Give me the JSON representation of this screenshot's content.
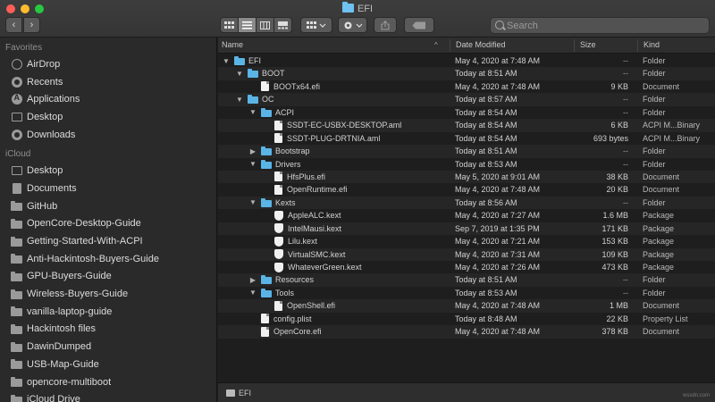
{
  "window": {
    "title": "EFI"
  },
  "toolbar": {
    "back_label": "‹",
    "forward_label": "›",
    "search_placeholder": "Search"
  },
  "sidebar": {
    "favorites_header": "Favorites",
    "favorites": [
      {
        "label": "AirDrop",
        "icon": "airdrop-icon"
      },
      {
        "label": "Recents",
        "icon": "clock-icon"
      },
      {
        "label": "Applications",
        "icon": "applications-icon"
      },
      {
        "label": "Desktop",
        "icon": "desktop-icon"
      },
      {
        "label": "Downloads",
        "icon": "downloads-icon"
      }
    ],
    "icloud_header": "iCloud",
    "icloud": [
      {
        "label": "Desktop",
        "icon": "desktop-icon"
      },
      {
        "label": "Documents",
        "icon": "documents-icon"
      },
      {
        "label": "GitHub",
        "icon": "folder-icon"
      },
      {
        "label": "OpenCore-Desktop-Guide",
        "icon": "folder-icon"
      },
      {
        "label": "Getting-Started-With-ACPI",
        "icon": "folder-icon"
      },
      {
        "label": "Anti-Hackintosh-Buyers-Guide",
        "icon": "folder-icon"
      },
      {
        "label": "GPU-Buyers-Guide",
        "icon": "folder-icon"
      },
      {
        "label": "Wireless-Buyers-Guide",
        "icon": "folder-icon"
      },
      {
        "label": "vanilla-laptop-guide",
        "icon": "folder-icon"
      },
      {
        "label": "Hackintosh files",
        "icon": "folder-icon"
      },
      {
        "label": "DawinDumped",
        "icon": "folder-icon"
      },
      {
        "label": "USB-Map-Guide",
        "icon": "folder-icon"
      },
      {
        "label": "opencore-multiboot",
        "icon": "folder-icon"
      },
      {
        "label": "iCloud Drive",
        "icon": "cloud-icon"
      }
    ]
  },
  "columns": {
    "name": "Name",
    "date": "Date Modified",
    "size": "Size",
    "kind": "Kind"
  },
  "files": [
    {
      "name": "EFI",
      "type": "folder",
      "depth": 0,
      "expanded": true,
      "date": "May 4, 2020 at 7:48 AM",
      "size": "--",
      "kind": "Folder"
    },
    {
      "name": "BOOT",
      "type": "folder",
      "depth": 1,
      "expanded": true,
      "date": "Today at 8:51 AM",
      "size": "--",
      "kind": "Folder"
    },
    {
      "name": "BOOTx64.efi",
      "type": "doc",
      "depth": 2,
      "date": "May 4, 2020 at 7:48 AM",
      "size": "9 KB",
      "kind": "Document"
    },
    {
      "name": "OC",
      "type": "folder",
      "depth": 1,
      "expanded": true,
      "date": "Today at 8:57 AM",
      "size": "--",
      "kind": "Folder"
    },
    {
      "name": "ACPI",
      "type": "folder",
      "depth": 2,
      "expanded": true,
      "date": "Today at 8:54 AM",
      "size": "--",
      "kind": "Folder"
    },
    {
      "name": "SSDT-EC-USBX-DESKTOP.aml",
      "type": "doc",
      "depth": 3,
      "date": "Today at 8:54 AM",
      "size": "6 KB",
      "kind": "ACPI M...Binary"
    },
    {
      "name": "SSDT-PLUG-DRTNIA.aml",
      "type": "doc",
      "depth": 3,
      "date": "Today at 8:54 AM",
      "size": "693 bytes",
      "kind": "ACPI M...Binary"
    },
    {
      "name": "Bootstrap",
      "type": "folder",
      "depth": 2,
      "expanded": false,
      "date": "Today at 8:51 AM",
      "size": "--",
      "kind": "Folder"
    },
    {
      "name": "Drivers",
      "type": "folder",
      "depth": 2,
      "expanded": true,
      "date": "Today at 8:53 AM",
      "size": "--",
      "kind": "Folder"
    },
    {
      "name": "HfsPlus.efi",
      "type": "doc",
      "depth": 3,
      "date": "May 5, 2020 at 9:01 AM",
      "size": "38 KB",
      "kind": "Document"
    },
    {
      "name": "OpenRuntime.efi",
      "type": "doc",
      "depth": 3,
      "date": "May 4, 2020 at 7:48 AM",
      "size": "20 KB",
      "kind": "Document"
    },
    {
      "name": "Kexts",
      "type": "folder",
      "depth": 2,
      "expanded": true,
      "date": "Today at 8:56 AM",
      "size": "--",
      "kind": "Folder"
    },
    {
      "name": "AppleALC.kext",
      "type": "kext",
      "depth": 3,
      "date": "May 4, 2020 at 7:27 AM",
      "size": "1.6 MB",
      "kind": "Package"
    },
    {
      "name": "IntelMausi.kext",
      "type": "kext",
      "depth": 3,
      "date": "Sep 7, 2019 at 1:35 PM",
      "size": "171 KB",
      "kind": "Package"
    },
    {
      "name": "Lilu.kext",
      "type": "kext",
      "depth": 3,
      "date": "May 4, 2020 at 7:21 AM",
      "size": "153 KB",
      "kind": "Package"
    },
    {
      "name": "VirtualSMC.kext",
      "type": "kext",
      "depth": 3,
      "date": "May 4, 2020 at 7:31 AM",
      "size": "109 KB",
      "kind": "Package"
    },
    {
      "name": "WhateverGreen.kext",
      "type": "kext",
      "depth": 3,
      "date": "May 4, 2020 at 7:26 AM",
      "size": "473 KB",
      "kind": "Package"
    },
    {
      "name": "Resources",
      "type": "folder",
      "depth": 2,
      "expanded": false,
      "date": "Today at 8:51 AM",
      "size": "--",
      "kind": "Folder"
    },
    {
      "name": "Tools",
      "type": "folder",
      "depth": 2,
      "expanded": true,
      "date": "Today at 8:53 AM",
      "size": "--",
      "kind": "Folder"
    },
    {
      "name": "OpenShell.efi",
      "type": "doc",
      "depth": 3,
      "date": "May 4, 2020 at 7:48 AM",
      "size": "1 MB",
      "kind": "Document"
    },
    {
      "name": "config.plist",
      "type": "doc",
      "depth": 2,
      "date": "Today at 8:48 AM",
      "size": "22 KB",
      "kind": "Property List"
    },
    {
      "name": "OpenCore.efi",
      "type": "doc",
      "depth": 2,
      "date": "May 4, 2020 at 7:48 AM",
      "size": "378 KB",
      "kind": "Document"
    }
  ],
  "pathbar": {
    "label": "EFI"
  },
  "watermark": "wsxdn.com",
  "colors": {
    "folder": "#5ab4e6",
    "sidebar_bg": "#2a2a2a",
    "list_bg": "#1e1e1e"
  }
}
